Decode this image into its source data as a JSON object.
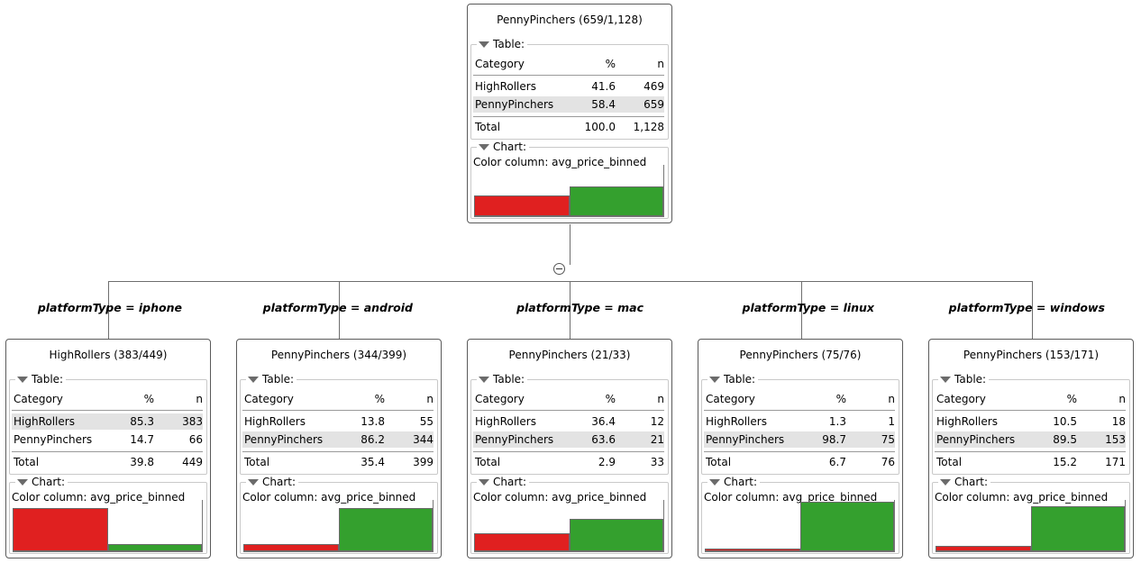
{
  "colors": {
    "red": "#e02020",
    "green": "#34a02e"
  },
  "labels": {
    "table": "Table:",
    "chart": "Chart:",
    "category": "Category",
    "pct": "%",
    "n": "n",
    "total": "Total",
    "color_column": "Color column: avg_price_binned"
  },
  "root": {
    "title": "PennyPinchers (659/1,128)",
    "rows": [
      {
        "category": "HighRollers",
        "pct": "41.6",
        "n": "469",
        "highlight": false
      },
      {
        "category": "PennyPinchers",
        "pct": "58.4",
        "n": "659",
        "highlight": true
      }
    ],
    "total": {
      "pct": "100.0",
      "n": "1,128"
    },
    "bars": [
      41.6,
      58.4
    ]
  },
  "children": [
    {
      "edge_label": "platformType = iphone",
      "title": "HighRollers (383/449)",
      "rows": [
        {
          "category": "HighRollers",
          "pct": "85.3",
          "n": "383",
          "highlight": true
        },
        {
          "category": "PennyPinchers",
          "pct": "14.7",
          "n": "66",
          "highlight": false
        }
      ],
      "total": {
        "pct": "39.8",
        "n": "449"
      },
      "bars": [
        85.3,
        14.7
      ]
    },
    {
      "edge_label": "platformType = android",
      "title": "PennyPinchers (344/399)",
      "rows": [
        {
          "category": "HighRollers",
          "pct": "13.8",
          "n": "55",
          "highlight": false
        },
        {
          "category": "PennyPinchers",
          "pct": "86.2",
          "n": "344",
          "highlight": true
        }
      ],
      "total": {
        "pct": "35.4",
        "n": "399"
      },
      "bars": [
        13.8,
        86.2
      ]
    },
    {
      "edge_label": "platformType = mac",
      "title": "PennyPinchers (21/33)",
      "rows": [
        {
          "category": "HighRollers",
          "pct": "36.4",
          "n": "12",
          "highlight": false
        },
        {
          "category": "PennyPinchers",
          "pct": "63.6",
          "n": "21",
          "highlight": true
        }
      ],
      "total": {
        "pct": "2.9",
        "n": "33"
      },
      "bars": [
        36.4,
        63.6
      ]
    },
    {
      "edge_label": "platformType = linux",
      "title": "PennyPinchers (75/76)",
      "rows": [
        {
          "category": "HighRollers",
          "pct": "1.3",
          "n": "1",
          "highlight": false
        },
        {
          "category": "PennyPinchers",
          "pct": "98.7",
          "n": "75",
          "highlight": true
        }
      ],
      "total": {
        "pct": "6.7",
        "n": "76"
      },
      "bars": [
        1.3,
        98.7
      ]
    },
    {
      "edge_label": "platformType = windows",
      "title": "PennyPinchers (153/171)",
      "rows": [
        {
          "category": "HighRollers",
          "pct": "10.5",
          "n": "18",
          "highlight": false
        },
        {
          "category": "PennyPinchers",
          "pct": "89.5",
          "n": "153",
          "highlight": true
        }
      ],
      "total": {
        "pct": "15.2",
        "n": "171"
      },
      "bars": [
        10.5,
        89.5
      ]
    }
  ]
}
